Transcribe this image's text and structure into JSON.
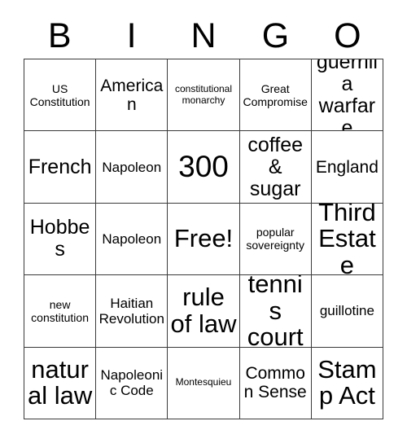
{
  "card": {
    "title": "BINGO",
    "header_letters": [
      "B",
      "I",
      "N",
      "G",
      "O"
    ],
    "columns": 5,
    "rows": 5,
    "border_color": "#3a3a3a",
    "background_color": "#ffffff",
    "text_color": "#000000",
    "free_space_label": "Free!",
    "free_space_position": "center",
    "cells": [
      [
        {
          "text": "US Constitution",
          "size": "s"
        },
        {
          "text": "American",
          "size": "l"
        },
        {
          "text": "constitutional monarchy",
          "size": "xs"
        },
        {
          "text": "Great Compromise",
          "size": "s"
        },
        {
          "text": "guerrilla warfare",
          "size": "xl"
        }
      ],
      [
        {
          "text": "French",
          "size": "xl"
        },
        {
          "text": "Napoleon",
          "size": "m"
        },
        {
          "text": "300",
          "size": "huge"
        },
        {
          "text": "coffee & sugar",
          "size": "xl"
        },
        {
          "text": "England",
          "size": "l"
        }
      ],
      [
        {
          "text": "Hobbes",
          "size": "xl"
        },
        {
          "text": "Napoleon",
          "size": "m"
        },
        {
          "text": "Free!",
          "size": "xxl"
        },
        {
          "text": "popular sovereignty",
          "size": "s"
        },
        {
          "text": "Third Estate",
          "size": "xxl"
        }
      ],
      [
        {
          "text": "new constitution",
          "size": "s"
        },
        {
          "text": "Haitian Revolution",
          "size": "m"
        },
        {
          "text": "rule of law",
          "size": "xxl"
        },
        {
          "text": "tennis court",
          "size": "xxl"
        },
        {
          "text": "guillotine",
          "size": "m"
        }
      ],
      [
        {
          "text": "natural law",
          "size": "xxl"
        },
        {
          "text": "Napoleonic Code",
          "size": "m"
        },
        {
          "text": "Montesquieu",
          "size": "xs"
        },
        {
          "text": "Common Sense",
          "size": "l"
        },
        {
          "text": "Stamp Act",
          "size": "xxl"
        }
      ]
    ]
  }
}
